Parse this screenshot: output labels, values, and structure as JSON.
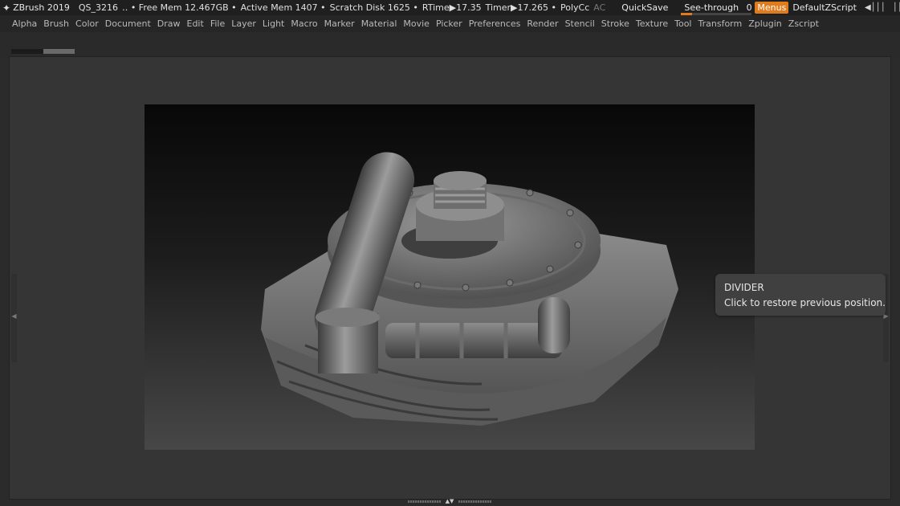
{
  "titlebar": {
    "app_name": "ZBrush 2019",
    "quicksketch": "QS_3216",
    "free_mem": "‥ • Free Mem 12.467GB •",
    "active_mem": "Active Mem 1407 •",
    "scratch_disk": "Scratch Disk 1625 •",
    "rtime": "RTime▶17.35",
    "timer": "Timer▶17.265 •",
    "polycount": "PolyCc",
    "polycount_tail": "AC",
    "quicksave": "QuickSave",
    "see_through_label": "See-through",
    "see_through_value": "0",
    "menus": "Menus",
    "script": "DefaultZScript",
    "icons": [
      "layout-prev-icon",
      "layout-next-icon",
      "interface-icon",
      "colors-icon",
      "lock-icon",
      "minimize-icon",
      "restore-icon",
      "close-icon"
    ],
    "accent_color": "#e07b1e"
  },
  "menubar": {
    "items": [
      "Alpha",
      "Brush",
      "Color",
      "Document",
      "Draw",
      "Edit",
      "File",
      "Layer",
      "Light",
      "Macro",
      "Marker",
      "Material",
      "Movie",
      "Picker",
      "Preferences",
      "Render",
      "Stencil",
      "Stroke",
      "Texture",
      "Tool",
      "Transform",
      "Zplugin",
      "Zscript"
    ]
  },
  "tooltip": {
    "title": "DIVIDER",
    "text": "Click to restore previous position."
  },
  "canvas": {
    "subject": "sculpted pipe and valve model on rock base"
  }
}
